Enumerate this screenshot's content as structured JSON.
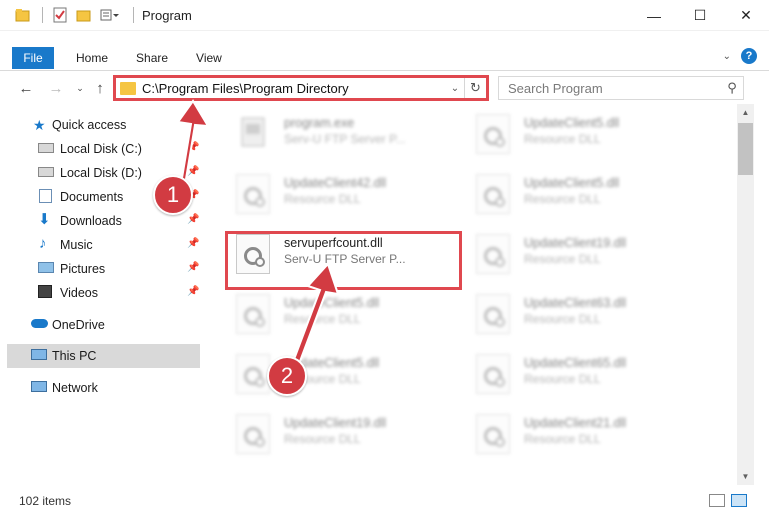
{
  "window": {
    "title": "Program",
    "controls": {
      "minimize": "—",
      "maximize": "☐",
      "close": "✕"
    }
  },
  "ribbon": {
    "file": "File",
    "tabs": [
      "Home",
      "Share",
      "View"
    ]
  },
  "address": {
    "path": "C:\\Program Files\\Program Directory",
    "search_placeholder": "Search Program"
  },
  "sidebar": {
    "quick_access": "Quick access",
    "items": [
      {
        "label": "Local Disk (C:)",
        "icon": "drive-icon",
        "pinned": true
      },
      {
        "label": "Local Disk (D:)",
        "icon": "drive-icon",
        "pinned": true
      },
      {
        "label": "Documents",
        "icon": "documents-icon",
        "pinned": true
      },
      {
        "label": "Downloads",
        "icon": "downloads-icon",
        "pinned": true
      },
      {
        "label": "Music",
        "icon": "music-icon",
        "pinned": true
      },
      {
        "label": "Pictures",
        "icon": "pictures-icon",
        "pinned": true
      },
      {
        "label": "Videos",
        "icon": "videos-icon",
        "pinned": true
      }
    ],
    "onedrive": "OneDrive",
    "this_pc": "This PC",
    "network": "Network"
  },
  "files": {
    "col1": [
      {
        "name": "program.exe",
        "desc": "Serv-U FTP Server P..."
      },
      {
        "name": "UpdateClient42.dll",
        "desc": "Resource DLL"
      },
      {
        "name": "servuperfcount.dll",
        "desc": "Serv-U FTP Server P..."
      },
      {
        "name": "UpdateClient5.dll",
        "desc": "Resource DLL"
      },
      {
        "name": "UpdateClient5.dll",
        "desc": "Resource DLL"
      },
      {
        "name": "UpdateClient19.dll",
        "desc": "Resource DLL"
      }
    ],
    "col2": [
      {
        "name": "UpdateClient5.dll",
        "desc": "Resource DLL"
      },
      {
        "name": "UpdateClient5.dll",
        "desc": "Resource DLL"
      },
      {
        "name": "UpdateClient19.dll",
        "desc": "Resource DLL"
      },
      {
        "name": "UpdateClient63.dll",
        "desc": "Resource DLL"
      },
      {
        "name": "UpdateClient65.dll",
        "desc": "Resource DLL"
      },
      {
        "name": "UpdateClient21.dll",
        "desc": "Resource DLL"
      }
    ]
  },
  "status": {
    "count": "102 items"
  },
  "annotations": {
    "step1": "1",
    "step2": "2",
    "color": "#d23b42"
  }
}
